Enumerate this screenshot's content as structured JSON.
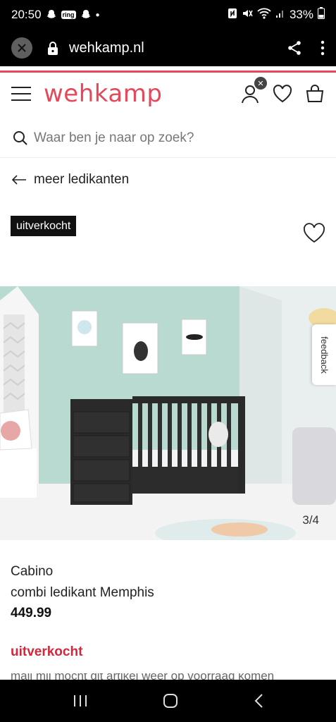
{
  "status": {
    "time": "20:50",
    "ring_label": "ring",
    "battery": "33%"
  },
  "browser": {
    "url": "wehkamp.nl"
  },
  "header": {
    "logo": "wehkamp"
  },
  "search": {
    "placeholder": "Waar ben je naar op zoek?"
  },
  "nav": {
    "back_label": "meer ledikanten"
  },
  "product": {
    "sold_badge": "uitverkocht",
    "image_counter": "3/4",
    "brand": "Cabino",
    "name": "combi ledikant Memphis",
    "price": "449.99",
    "availability": "uitverkocht",
    "notify_text": "mail mij mocht dit artikel weer op voorraad komen"
  },
  "feedback": {
    "label": "feedback"
  },
  "colors": {
    "brand": "#e4495b",
    "sold_out": "#d0293d"
  }
}
